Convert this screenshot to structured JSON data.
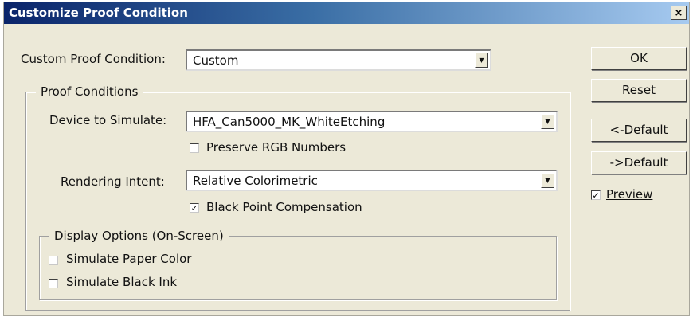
{
  "window": {
    "title": "Customize Proof Condition",
    "close_glyph": "×"
  },
  "custom_proof_condition": {
    "label": "Custom Proof Condition:",
    "value": "Custom"
  },
  "proof_conditions": {
    "legend": "Proof Conditions",
    "device_label": "Device to Simulate:",
    "device_value": "HFA_Can5000_MK_WhiteEtching",
    "preserve_rgb": {
      "label": "Preserve RGB Numbers",
      "checked": false
    },
    "rendering_label": "Rendering Intent:",
    "rendering_value": "Relative Colorimetric",
    "black_point": {
      "label": "Black Point Compensation",
      "checked": true
    }
  },
  "display_options": {
    "legend": "Display Options (On-Screen)",
    "paper_color": {
      "label": "Simulate Paper Color",
      "checked": false
    },
    "black_ink": {
      "label": "Simulate Black Ink",
      "checked": false
    }
  },
  "buttons": {
    "ok": "OK",
    "reset": "Reset",
    "prev_default": "<-Default",
    "next_default": "->Default"
  },
  "preview": {
    "label": "Preview",
    "checked": true
  },
  "icons": {
    "check": "✓",
    "dropdown": "▼"
  }
}
